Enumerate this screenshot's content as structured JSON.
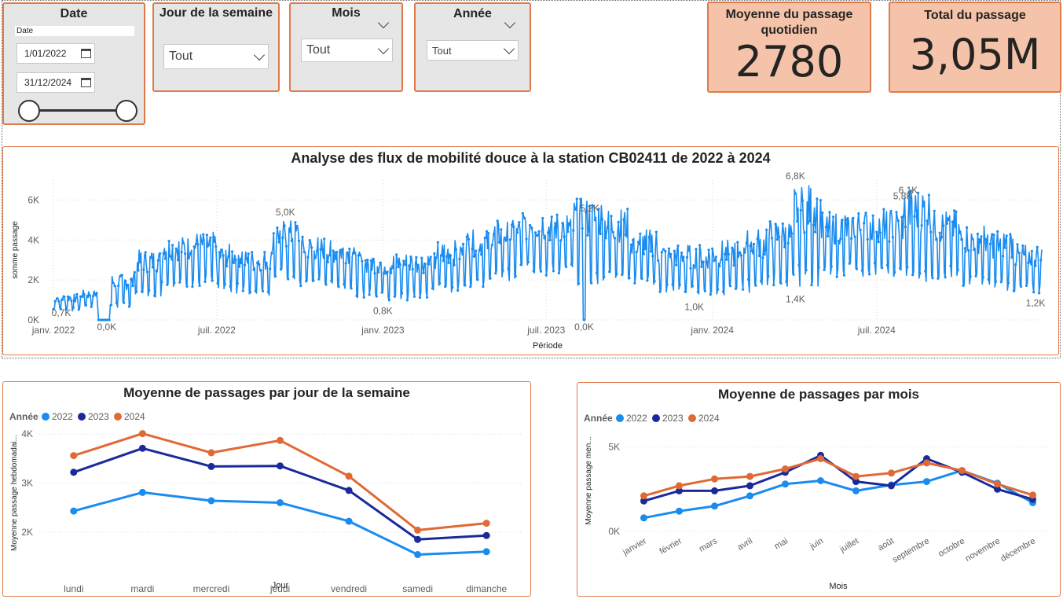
{
  "slicers": {
    "date": {
      "title": "Date",
      "label": "Date",
      "start": "1/01/2022",
      "end": "31/12/2024"
    },
    "weekday": {
      "title": "Jour de la semaine",
      "value": "Tout"
    },
    "month": {
      "title": "Mois",
      "value": "Tout"
    },
    "year": {
      "title": "Année",
      "value": "Tout"
    }
  },
  "kpis": {
    "daily_avg": {
      "title": "Moyenne du passage quotidien",
      "value": "2780"
    },
    "total": {
      "title": "Total du passage",
      "value": "3,05M"
    }
  },
  "colors": {
    "y2022": "#1a8cf0",
    "y2023": "#1b2a9a",
    "y2024": "#e06a35",
    "main_line": "#1a8cf0",
    "accent_border": "#e07a4b",
    "kpi_bg": "#f4c3aa"
  },
  "chart_data": [
    {
      "type": "line",
      "title": "Analyse des flux de mobilité douce à la station CB02411 de 2022 à 2024",
      "xlabel": "Période",
      "ylabel": "somme passage",
      "x_ticks": [
        "janv. 2022",
        "juil. 2022",
        "janv. 2023",
        "juil. 2023",
        "janv. 2024",
        "juil. 2024"
      ],
      "y_ticks": [
        "0K",
        "2K",
        "4K",
        "6K"
      ],
      "ylim": [
        0,
        7000
      ],
      "x_range": [
        "2022-01-01",
        "2024-12-31"
      ],
      "annotations": [
        {
          "date": "2022-01-05",
          "value": 700,
          "text": "0,7K"
        },
        {
          "date": "2022-03-01",
          "value": 0,
          "text": "0,0K"
        },
        {
          "date": "2022-09-15",
          "value": 5000,
          "text": "5,0K"
        },
        {
          "date": "2023-01-01",
          "value": 800,
          "text": "0,8K"
        },
        {
          "date": "2023-08-12",
          "value": 0,
          "text": "0,0K"
        },
        {
          "date": "2023-08-18",
          "value": 5200,
          "text": "5,2K"
        },
        {
          "date": "2023-12-12",
          "value": 1000,
          "text": "1,0K"
        },
        {
          "date": "2024-04-02",
          "value": 6800,
          "text": "6,8K"
        },
        {
          "date": "2024-04-02",
          "value": 1400,
          "text": "1,4K"
        },
        {
          "date": "2024-07-30",
          "value": 5800,
          "text": "5,8K"
        },
        {
          "date": "2024-08-05",
          "value": 6100,
          "text": "6,1K"
        },
        {
          "date": "2024-12-31",
          "value": 1200,
          "text": "1,2K"
        }
      ],
      "monthly_envelope": {
        "months": [
          "2022-01",
          "2022-02",
          "2022-03",
          "2022-04",
          "2022-05",
          "2022-06",
          "2022-07",
          "2022-08",
          "2022-09",
          "2022-10",
          "2022-11",
          "2022-12",
          "2023-01",
          "2023-02",
          "2023-03",
          "2023-04",
          "2023-05",
          "2023-06",
          "2023-07",
          "2023-08",
          "2023-09",
          "2023-10",
          "2023-11",
          "2023-12",
          "2024-01",
          "2024-02",
          "2024-03",
          "2024-04",
          "2024-05",
          "2024-06",
          "2024-07",
          "2024-08",
          "2024-09",
          "2024-10",
          "2024-11",
          "2024-12"
        ],
        "high": [
          1300,
          1500,
          2300,
          3500,
          4200,
          4400,
          3800,
          3500,
          5000,
          4200,
          4000,
          3400,
          3400,
          3400,
          4000,
          4500,
          5000,
          5600,
          5400,
          6100,
          5600,
          4600,
          3800,
          3800,
          4000,
          4600,
          5000,
          6800,
          5400,
          5500,
          5600,
          6600,
          5500,
          4800,
          4600,
          3800
        ],
        "low": [
          400,
          600,
          500,
          1000,
          1500,
          1500,
          1200,
          1100,
          1800,
          1500,
          1400,
          1000,
          800,
          1000,
          1200,
          1500,
          1800,
          2000,
          2000,
          1500,
          1800,
          1400,
          1200,
          1000,
          1000,
          1200,
          1500,
          1400,
          1800,
          2000,
          1800,
          1600,
          1800,
          1500,
          1200,
          1200
        ]
      }
    },
    {
      "type": "line",
      "title": "Moyenne de passages par jour de la semaine",
      "legend_title": "Année",
      "xlabel": "Jour",
      "ylabel": "Moyenne passage hebdomadai...",
      "categories": [
        "lundi",
        "mardi",
        "mercredi",
        "jeudi",
        "vendredi",
        "samedi",
        "dimanche"
      ],
      "y_ticks": [
        "2K",
        "3K",
        "4K"
      ],
      "ylim": [
        1500,
        4100
      ],
      "series": [
        {
          "name": "2022",
          "values": [
            2430,
            2810,
            2640,
            2600,
            2220,
            1540,
            1600
          ]
        },
        {
          "name": "2023",
          "values": [
            3220,
            3710,
            3340,
            3350,
            2850,
            1850,
            1930
          ]
        },
        {
          "name": "2024",
          "values": [
            3560,
            4010,
            3620,
            3870,
            3140,
            2040,
            2180
          ]
        }
      ]
    },
    {
      "type": "line",
      "title": "Moyenne de passages par mois",
      "legend_title": "Année",
      "xlabel": "Mois",
      "ylabel": "Moyenne passage men...",
      "categories": [
        "janvier",
        "février",
        "mars",
        "avril",
        "mai",
        "juin",
        "juillet",
        "août",
        "septembre",
        "octobre",
        "novembre",
        "décembre"
      ],
      "y_ticks": [
        "0K",
        "5K"
      ],
      "ylim": [
        0,
        6000
      ],
      "series": [
        {
          "name": "2022",
          "values": [
            800,
            1200,
            1500,
            2100,
            2800,
            3000,
            2400,
            2750,
            2950,
            3600,
            2850,
            1700
          ]
        },
        {
          "name": "2023",
          "values": [
            1800,
            2400,
            2400,
            2700,
            3500,
            4500,
            2950,
            2700,
            4300,
            3500,
            2500,
            1900
          ]
        },
        {
          "name": "2024",
          "values": [
            2100,
            2700,
            3100,
            3250,
            3700,
            4300,
            3250,
            3450,
            4050,
            3600,
            2800,
            2150
          ]
        }
      ]
    }
  ]
}
